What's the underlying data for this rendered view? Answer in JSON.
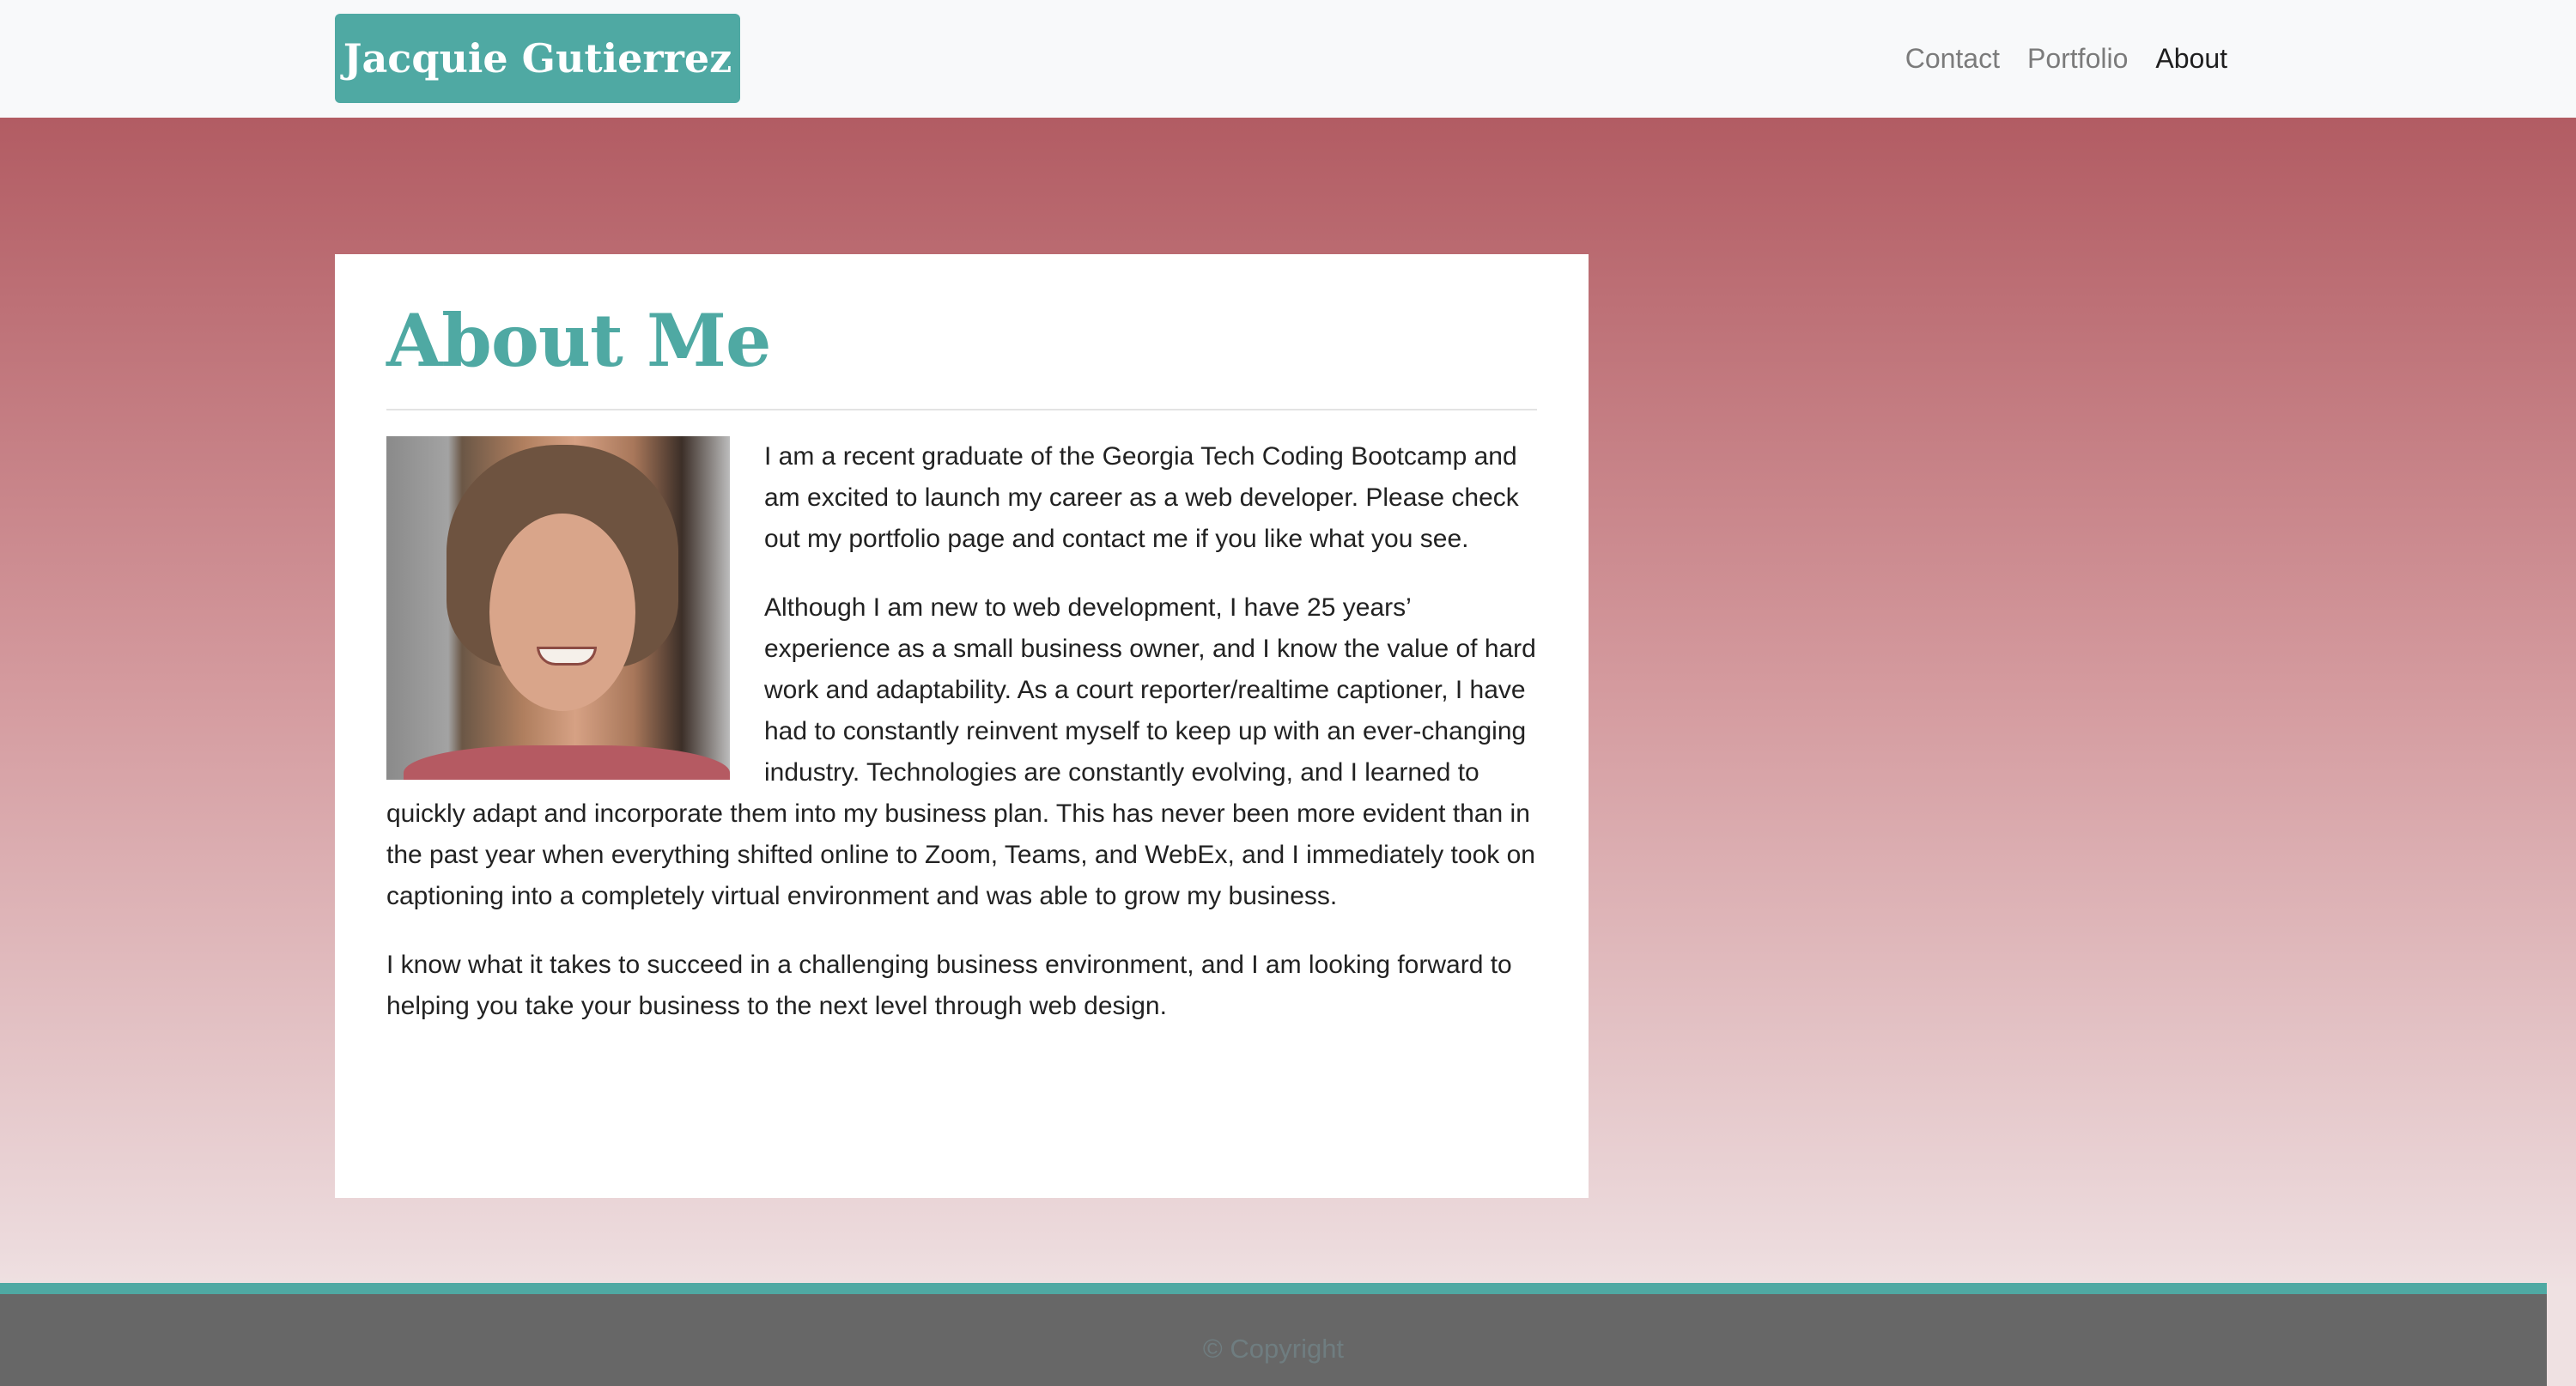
{
  "header": {
    "brand": "Jacquie Gutierrez",
    "nav": [
      {
        "label": "Contact"
      },
      {
        "label": "Portfolio"
      },
      {
        "label": "About",
        "active": true
      }
    ]
  },
  "main": {
    "title": "About Me",
    "photo_alt": "Portrait of Jacquie Gutierrez",
    "paragraphs": [
      "I am a recent graduate of the Georgia Tech Coding Bootcamp and am excited to launch my career as a web developer. Please check out my portfolio page and contact me if you like what you see.",
      "Although I am new to web development, I have 25 years’ experience as a small business owner, and I know the value of hard work and adaptability. As a court reporter/realtime captioner, I have had to constantly reinvent myself to keep up with an ever-changing industry. Technologies are constantly evolving, and I learned to quickly adapt and incorporate them into my business plan. This has never been more evident than in the past year when everything shifted online to Zoom, Teams, and WebEx, and I immediately took on captioning into a completely virtual environment and was able to grow my business.",
      "I know what it takes to succeed in a challenging business environment, and I am looking forward to helping you take your business to the next level through web design."
    ]
  },
  "footer": {
    "copyright": "© Copyright"
  },
  "colors": {
    "accent": "#4fa9a3",
    "navbar_bg": "#f8f9fa",
    "gradient_top": "#b25c63",
    "gradient_bottom": "#efe1e2",
    "footer_bg": "#676767"
  }
}
